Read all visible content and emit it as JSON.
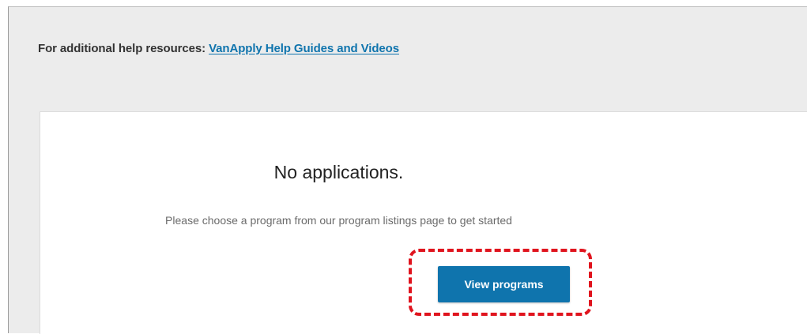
{
  "help": {
    "prefix": "For additional help resources: ",
    "link_label": "VanApply Help Guides and Videos"
  },
  "empty_state": {
    "title": "No applications.",
    "subtitle": "Please choose a program from our program listings page to get started",
    "button_label": "View programs"
  },
  "colors": {
    "accent": "#0f74ad",
    "highlight": "#e0141e",
    "panel_background": "#ececec"
  }
}
